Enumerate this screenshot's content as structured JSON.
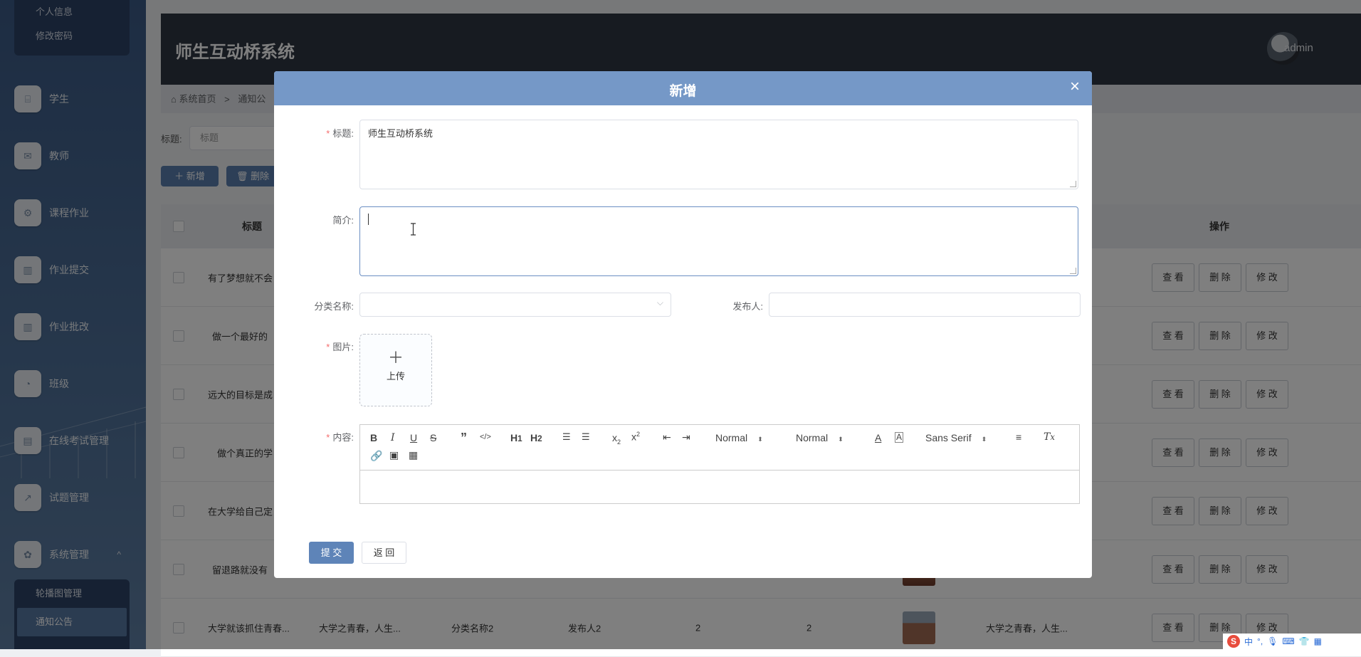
{
  "sidebar": {
    "top_sub": [
      "个人信息",
      "修改密码"
    ],
    "menu": [
      {
        "label": "学生",
        "icon": "⌸"
      },
      {
        "label": "教师",
        "icon": "✉"
      },
      {
        "label": "课程作业",
        "icon": "⚙"
      },
      {
        "label": "作业提交",
        "icon": "▥"
      },
      {
        "label": "作业批改",
        "icon": "▥"
      },
      {
        "label": "班级",
        "icon": "◔"
      },
      {
        "label": "在线考试管理",
        "icon": "▤"
      },
      {
        "label": "试题管理",
        "icon": "↗"
      },
      {
        "label": "系统管理",
        "icon": "✿",
        "arrow": "^"
      }
    ],
    "bottom_sub": [
      "轮播图管理",
      "通知公告"
    ]
  },
  "header": {
    "title": "师生互动桥系统",
    "user": "admin"
  },
  "breadcrumb": {
    "home": "系统首页",
    "sep": ">",
    "current": "通知公"
  },
  "search": {
    "label": "标题:",
    "placeholder": "标题"
  },
  "actions": {
    "add": "新增",
    "delete": "删除"
  },
  "table": {
    "headers": {
      "title": "标题",
      "ops": "操作"
    },
    "ops": {
      "view": "查 看",
      "delete": "删 除",
      "edit": "修 改"
    },
    "rows": [
      {
        "title": "有了梦想就不会"
      },
      {
        "title": "做一个最好的"
      },
      {
        "title": "远大的目标是成"
      },
      {
        "title": "做个真正的学"
      },
      {
        "title": "在大学给自己定"
      },
      {
        "title": "留退路就没有"
      },
      {
        "title": "大学就该抓住青春...",
        "intro": "大学之青春，人生...",
        "category": "分类名称2",
        "publisher": "发布人2",
        "n1": "2",
        "n2": "2",
        "content": "大学之青春，人生..."
      }
    ]
  },
  "modal": {
    "title": "新增",
    "close": "×",
    "fields": {
      "title_label": "标题",
      "title_value": "师生互动桥系统",
      "intro_label": "简介",
      "category_label": "分类名称",
      "publisher_label": "发布人",
      "image_label": "图片",
      "upload_text": "上传",
      "content_label": "内容"
    },
    "toolbar": {
      "size": "Normal",
      "header": "Normal",
      "font": "Sans Serif"
    },
    "submit": "提 交",
    "back": "返 回"
  },
  "tray": {
    "lang": "中"
  }
}
